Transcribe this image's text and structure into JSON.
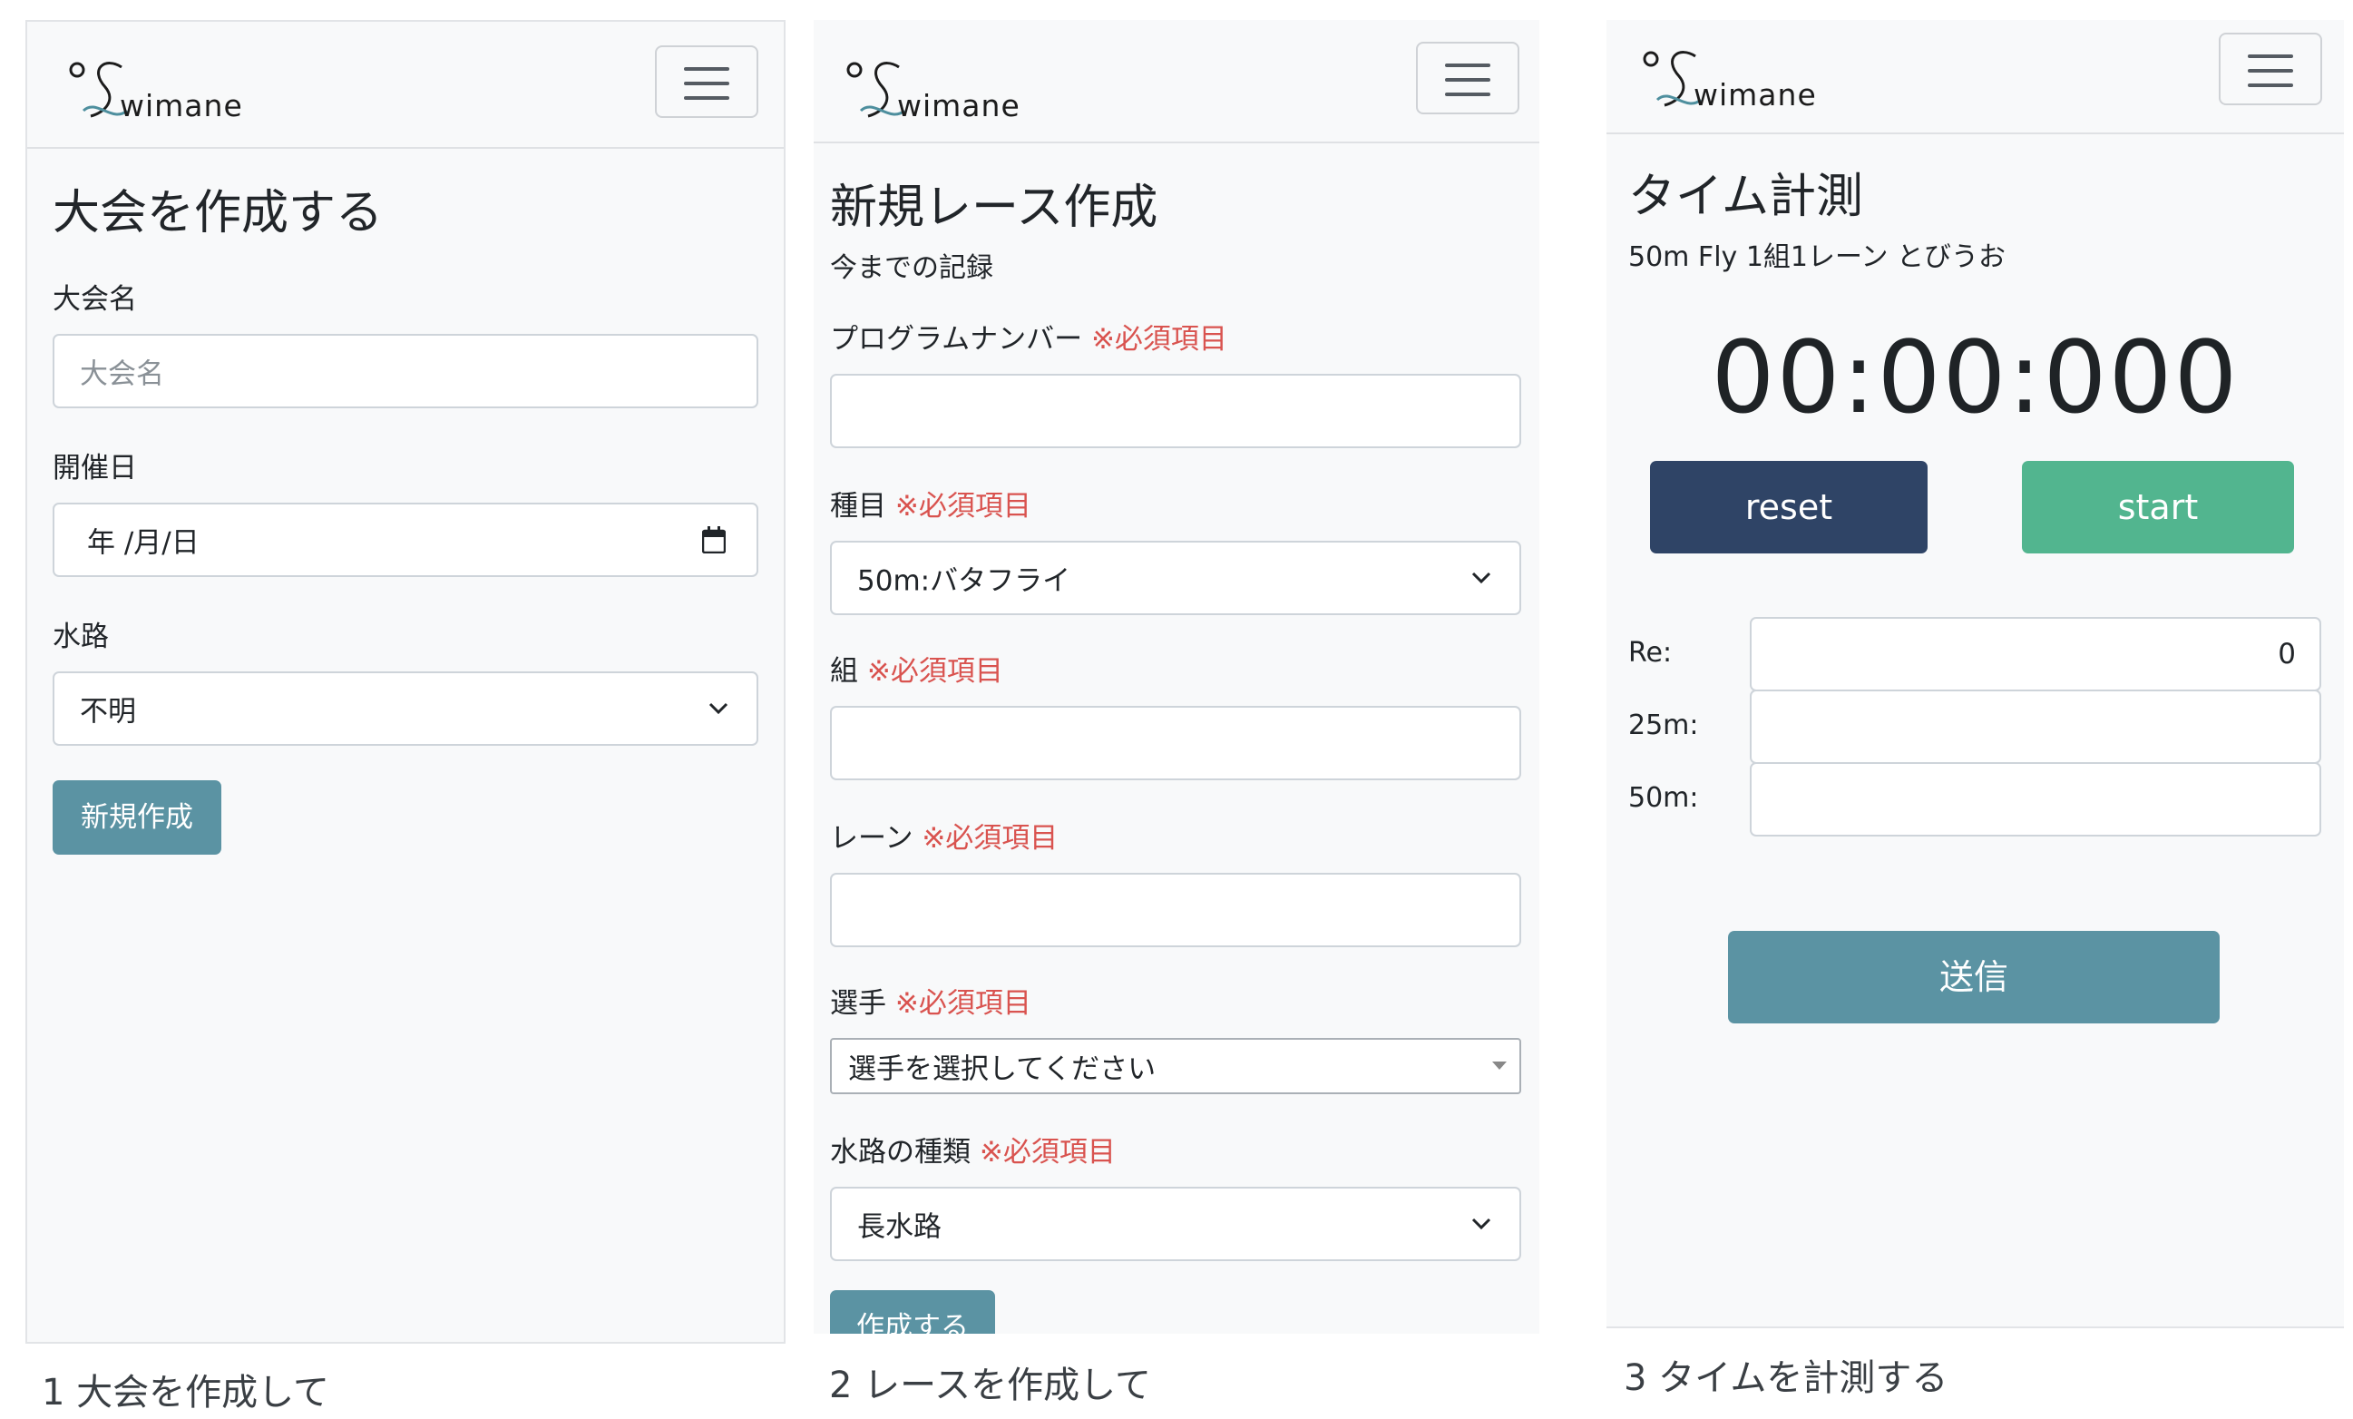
{
  "brand": {
    "logo_text": "wimane"
  },
  "colors": {
    "accent": "#5b93a3",
    "required": "#d9534f",
    "reset": "#2f4466",
    "start": "#52b58f"
  },
  "panel1": {
    "title": "大会を作成する",
    "name_label": "大会名",
    "name_placeholder": "大会名",
    "date_label": "開催日",
    "date_value": "年 /月/日",
    "pool_label": "水路",
    "pool_value": "不明",
    "submit": "新規作成",
    "caption": "1 大会を作成して"
  },
  "panel2": {
    "title": "新規レース作成",
    "subtitle": "今までの記録",
    "required": "※必須項目",
    "program_label": "プログラムナンバー",
    "event_label": "種目",
    "event_value": "50m:バタフライ",
    "heat_label": "組",
    "lane_label": "レーン",
    "swimmer_label": "選手",
    "swimmer_value": "選手を選択してください",
    "pool_label": "水路の種類",
    "pool_value": "長水路",
    "submit": "作成する",
    "caption": "2 レースを作成して"
  },
  "panel3": {
    "title": "タイム計測",
    "subtitle": "50m Fly 1組1レーン とびうお",
    "timer": "00:00:000",
    "reset": "reset",
    "start": "start",
    "re_label": "Re:",
    "re_value": "0",
    "split25_label": "25m:",
    "split50_label": "50m:",
    "submit": "送信",
    "caption": "3 タイムを計測する"
  }
}
